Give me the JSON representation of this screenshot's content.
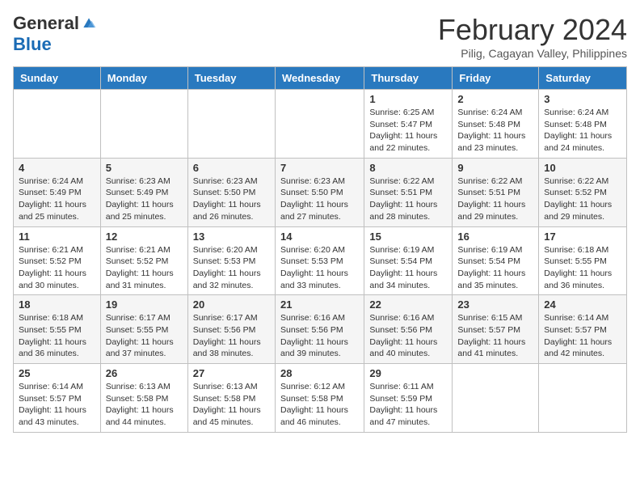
{
  "logo": {
    "general": "General",
    "blue": "Blue"
  },
  "header": {
    "title": "February 2024",
    "subtitle": "Pilig, Cagayan Valley, Philippines"
  },
  "weekdays": [
    "Sunday",
    "Monday",
    "Tuesday",
    "Wednesday",
    "Thursday",
    "Friday",
    "Saturday"
  ],
  "rows": [
    [
      {
        "day": "",
        "sunrise": "",
        "sunset": "",
        "daylight": ""
      },
      {
        "day": "",
        "sunrise": "",
        "sunset": "",
        "daylight": ""
      },
      {
        "day": "",
        "sunrise": "",
        "sunset": "",
        "daylight": ""
      },
      {
        "day": "",
        "sunrise": "",
        "sunset": "",
        "daylight": ""
      },
      {
        "day": "1",
        "sunrise": "6:25 AM",
        "sunset": "5:47 PM",
        "daylight": "11 hours and 22 minutes."
      },
      {
        "day": "2",
        "sunrise": "6:24 AM",
        "sunset": "5:48 PM",
        "daylight": "11 hours and 23 minutes."
      },
      {
        "day": "3",
        "sunrise": "6:24 AM",
        "sunset": "5:48 PM",
        "daylight": "11 hours and 24 minutes."
      }
    ],
    [
      {
        "day": "4",
        "sunrise": "6:24 AM",
        "sunset": "5:49 PM",
        "daylight": "11 hours and 25 minutes."
      },
      {
        "day": "5",
        "sunrise": "6:23 AM",
        "sunset": "5:49 PM",
        "daylight": "11 hours and 25 minutes."
      },
      {
        "day": "6",
        "sunrise": "6:23 AM",
        "sunset": "5:50 PM",
        "daylight": "11 hours and 26 minutes."
      },
      {
        "day": "7",
        "sunrise": "6:23 AM",
        "sunset": "5:50 PM",
        "daylight": "11 hours and 27 minutes."
      },
      {
        "day": "8",
        "sunrise": "6:22 AM",
        "sunset": "5:51 PM",
        "daylight": "11 hours and 28 minutes."
      },
      {
        "day": "9",
        "sunrise": "6:22 AM",
        "sunset": "5:51 PM",
        "daylight": "11 hours and 29 minutes."
      },
      {
        "day": "10",
        "sunrise": "6:22 AM",
        "sunset": "5:52 PM",
        "daylight": "11 hours and 29 minutes."
      }
    ],
    [
      {
        "day": "11",
        "sunrise": "6:21 AM",
        "sunset": "5:52 PM",
        "daylight": "11 hours and 30 minutes."
      },
      {
        "day": "12",
        "sunrise": "6:21 AM",
        "sunset": "5:52 PM",
        "daylight": "11 hours and 31 minutes."
      },
      {
        "day": "13",
        "sunrise": "6:20 AM",
        "sunset": "5:53 PM",
        "daylight": "11 hours and 32 minutes."
      },
      {
        "day": "14",
        "sunrise": "6:20 AM",
        "sunset": "5:53 PM",
        "daylight": "11 hours and 33 minutes."
      },
      {
        "day": "15",
        "sunrise": "6:19 AM",
        "sunset": "5:54 PM",
        "daylight": "11 hours and 34 minutes."
      },
      {
        "day": "16",
        "sunrise": "6:19 AM",
        "sunset": "5:54 PM",
        "daylight": "11 hours and 35 minutes."
      },
      {
        "day": "17",
        "sunrise": "6:18 AM",
        "sunset": "5:55 PM",
        "daylight": "11 hours and 36 minutes."
      }
    ],
    [
      {
        "day": "18",
        "sunrise": "6:18 AM",
        "sunset": "5:55 PM",
        "daylight": "11 hours and 36 minutes."
      },
      {
        "day": "19",
        "sunrise": "6:17 AM",
        "sunset": "5:55 PM",
        "daylight": "11 hours and 37 minutes."
      },
      {
        "day": "20",
        "sunrise": "6:17 AM",
        "sunset": "5:56 PM",
        "daylight": "11 hours and 38 minutes."
      },
      {
        "day": "21",
        "sunrise": "6:16 AM",
        "sunset": "5:56 PM",
        "daylight": "11 hours and 39 minutes."
      },
      {
        "day": "22",
        "sunrise": "6:16 AM",
        "sunset": "5:56 PM",
        "daylight": "11 hours and 40 minutes."
      },
      {
        "day": "23",
        "sunrise": "6:15 AM",
        "sunset": "5:57 PM",
        "daylight": "11 hours and 41 minutes."
      },
      {
        "day": "24",
        "sunrise": "6:14 AM",
        "sunset": "5:57 PM",
        "daylight": "11 hours and 42 minutes."
      }
    ],
    [
      {
        "day": "25",
        "sunrise": "6:14 AM",
        "sunset": "5:57 PM",
        "daylight": "11 hours and 43 minutes."
      },
      {
        "day": "26",
        "sunrise": "6:13 AM",
        "sunset": "5:58 PM",
        "daylight": "11 hours and 44 minutes."
      },
      {
        "day": "27",
        "sunrise": "6:13 AM",
        "sunset": "5:58 PM",
        "daylight": "11 hours and 45 minutes."
      },
      {
        "day": "28",
        "sunrise": "6:12 AM",
        "sunset": "5:58 PM",
        "daylight": "11 hours and 46 minutes."
      },
      {
        "day": "29",
        "sunrise": "6:11 AM",
        "sunset": "5:59 PM",
        "daylight": "11 hours and 47 minutes."
      },
      {
        "day": "",
        "sunrise": "",
        "sunset": "",
        "daylight": ""
      },
      {
        "day": "",
        "sunrise": "",
        "sunset": "",
        "daylight": ""
      }
    ]
  ],
  "labels": {
    "sunrise": "Sunrise:",
    "sunset": "Sunset:",
    "daylight": "Daylight:"
  }
}
